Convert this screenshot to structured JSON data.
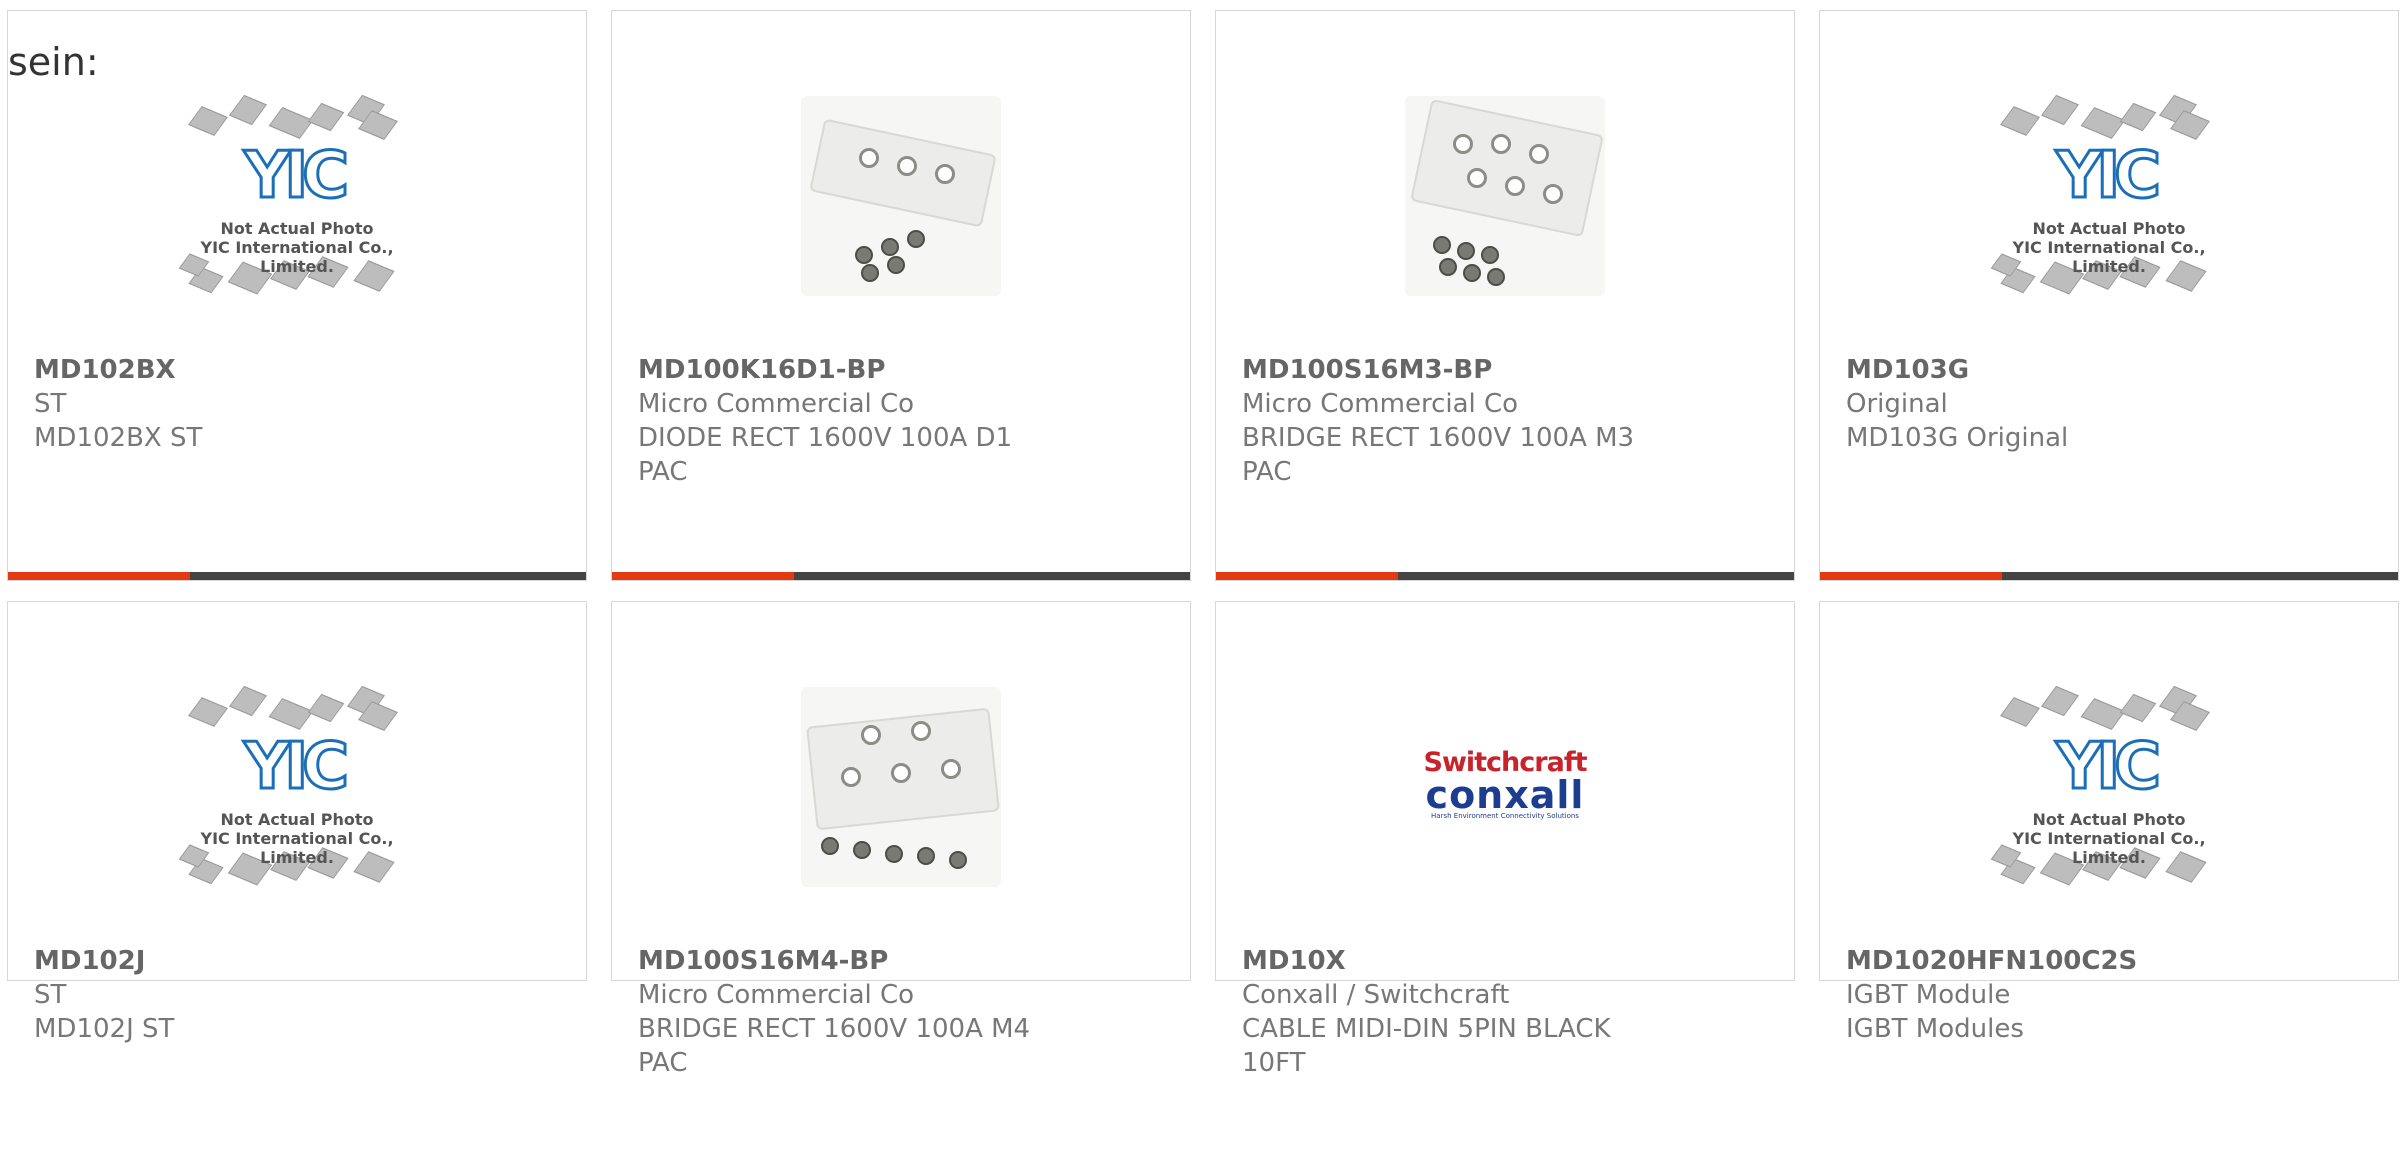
{
  "heading": "sein:",
  "products": [
    {
      "pn": "MD102BX",
      "mfr": "ST",
      "desc": "MD102BX ST",
      "image": "placeholder",
      "image_caption": [
        "Not Actual Photo",
        "YIC International Co., Limited."
      ]
    },
    {
      "pn": "MD100K16D1-BP",
      "mfr": "Micro Commercial Co",
      "desc": "DIODE RECT 1600V 100A D1 PAC",
      "image": "module-3"
    },
    {
      "pn": "MD100S16M3-BP",
      "mfr": "Micro Commercial Co",
      "desc": "BRIDGE RECT 1600V 100A M3 PAC",
      "image": "module-5"
    },
    {
      "pn": "MD103G",
      "mfr": "Original",
      "desc": "MD103G Original",
      "image": "placeholder",
      "image_caption": [
        "Not Actual Photo",
        "YIC International Co., Limited."
      ]
    },
    {
      "pn": "MD102J",
      "mfr": "ST",
      "desc": "MD102J ST",
      "image": "placeholder",
      "image_caption": [
        "Not Actual Photo",
        "YIC International Co., Limited."
      ]
    },
    {
      "pn": "MD100S16M4-BP",
      "mfr": "Micro Commercial Co",
      "desc": "BRIDGE RECT 1600V 100A M4 PAC",
      "image": "module-4"
    },
    {
      "pn": "MD10X",
      "mfr": "Conxall / Switchcraft",
      "desc": "CABLE MIDI-DIN 5PIN BLACK 10FT",
      "image": "logo",
      "logo_text": [
        "Switchcraft",
        "conxall",
        "Harsh Environment Connectivity Solutions"
      ]
    },
    {
      "pn": "MD1020HFN100C2S",
      "mfr": "IGBT Module",
      "desc": "IGBT Modules",
      "image": "placeholder",
      "image_caption": [
        "Not Actual Photo",
        "YIC International Co., Limited."
      ]
    }
  ],
  "placeholder_logo": "YIC",
  "colors": {
    "accent": "#e33a12",
    "bar": "#444444",
    "border": "#d6d6d6",
    "text": "#777777"
  }
}
